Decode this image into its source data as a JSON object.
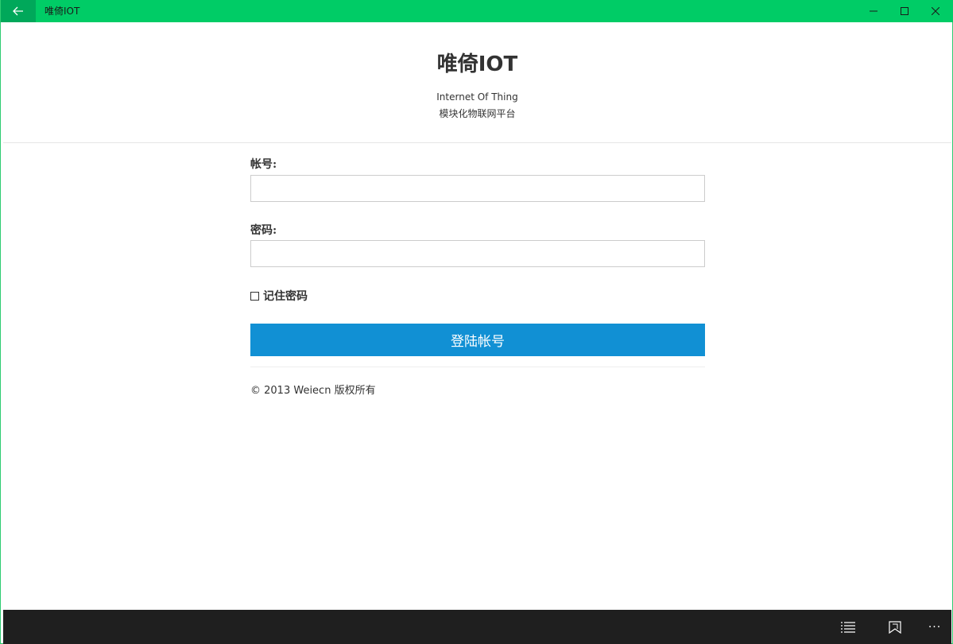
{
  "window": {
    "app_title": "唯倚IOT",
    "accent_color": "#00cc66",
    "icons": {
      "back": "back-arrow-icon",
      "minimize": "minimize-icon",
      "maximize": "maximize-icon",
      "close": "close-icon"
    }
  },
  "header": {
    "title": "唯倚IOT",
    "subtitle_en": "Internet Of Thing",
    "subtitle_cn": "模块化物联网平台"
  },
  "form": {
    "account_label": "帐号:",
    "account_value": "",
    "password_label": "密码:",
    "password_value": "",
    "remember_label": "记住密码",
    "remember_checked": false,
    "login_button": "登陆帐号",
    "button_color": "#1190d4"
  },
  "footer": {
    "copyright": "© 2013 Weiecn 版权所有"
  },
  "appbar": {
    "icons": [
      "list-icon",
      "bookmark-icon",
      "more-icon"
    ],
    "more_label": "···"
  }
}
